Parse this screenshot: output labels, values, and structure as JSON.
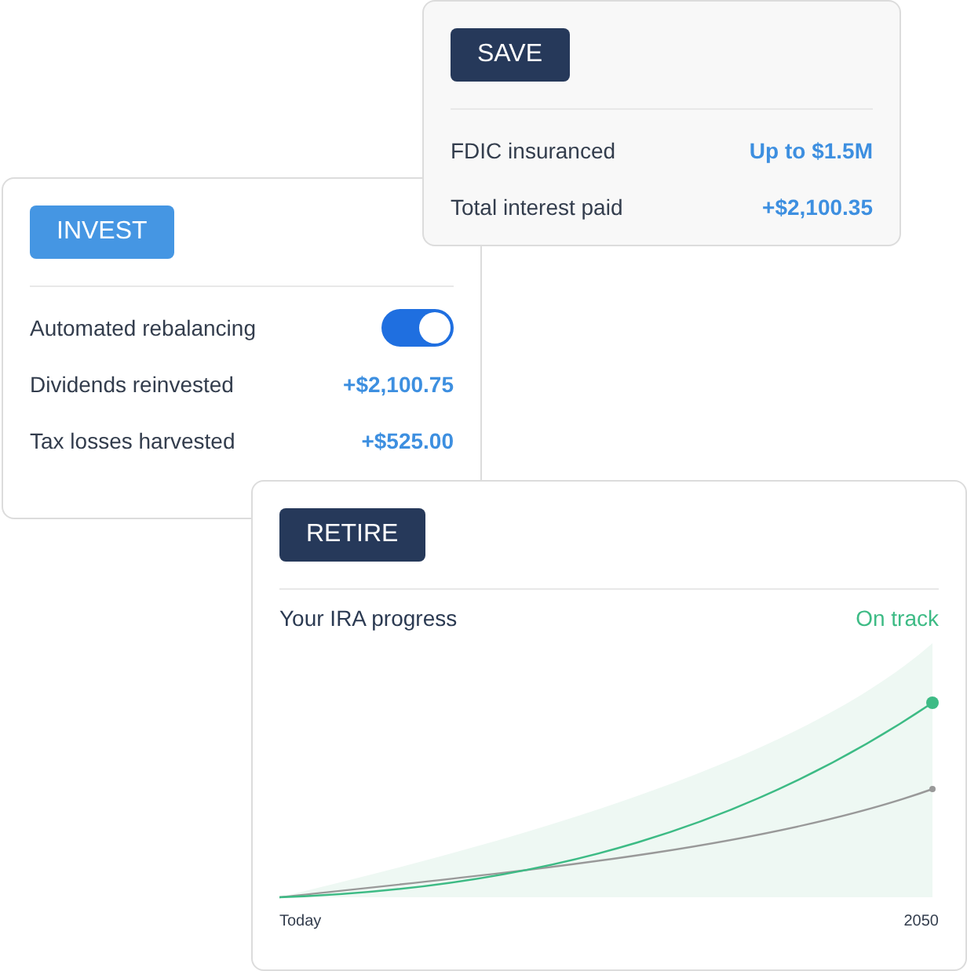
{
  "cards": [
    {
      "kind": "list",
      "tag": {
        "label": "SAVE",
        "color": "#26395a"
      },
      "rows": [
        {
          "kind": "value",
          "label": "FDIC insuranced",
          "value": "Up to $1.5M"
        },
        {
          "kind": "value",
          "label": "Total interest paid",
          "value": "+$2,100.35"
        }
      ]
    },
    {
      "kind": "list",
      "tag": {
        "label": "INVEST",
        "color": "#4596e3"
      },
      "rows": [
        {
          "kind": "toggle",
          "label": "Automated rebalancing",
          "on": true
        },
        {
          "kind": "value",
          "label": "Dividends reinvested",
          "value": "+$2,100.75"
        },
        {
          "kind": "value",
          "label": "Tax losses harvested",
          "value": "+$525.00"
        }
      ]
    },
    {
      "kind": "chart",
      "tag": {
        "label": "RETIRE",
        "color": "#26395a"
      },
      "title": "Your IRA progress",
      "status": "On track",
      "start_label": "Today",
      "end_label": "2050"
    }
  ]
}
